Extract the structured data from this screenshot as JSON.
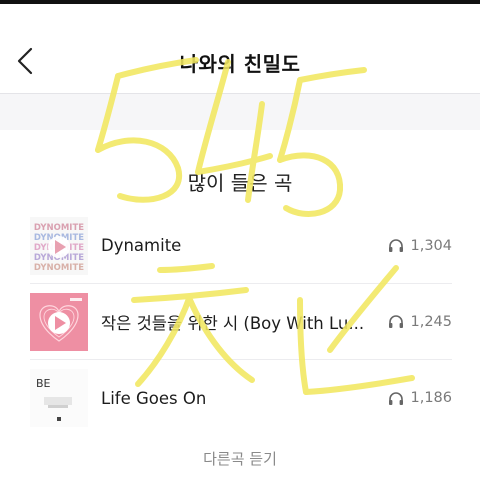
{
  "header": {
    "back_icon": "chevron-left-icon",
    "title": "나와의 친밀도"
  },
  "section": {
    "title": "많이 들은 곡"
  },
  "tracks": [
    {
      "title": "Dynamite",
      "plays": "1,304",
      "cover_text": [
        "DYNOMITE",
        "DYNOMITE",
        "DYNOMITE",
        "DYNOMITE",
        "DYNOMITE"
      ]
    },
    {
      "title": "작은 것들을 위한 시 (Boy With Lu...",
      "plays": "1,245",
      "cover_text": []
    },
    {
      "title": "Life Goes On",
      "plays": "1,186",
      "cover_text": [
        "BE"
      ]
    }
  ],
  "more": {
    "label": "다른곡 듣기"
  },
  "colors": {
    "scribble": "#f2e860",
    "pink_cover": "#ee8fa3",
    "play_badge": "#ffffff"
  },
  "icons": [
    "chevron-left-icon",
    "headphones-icon",
    "play-icon"
  ]
}
